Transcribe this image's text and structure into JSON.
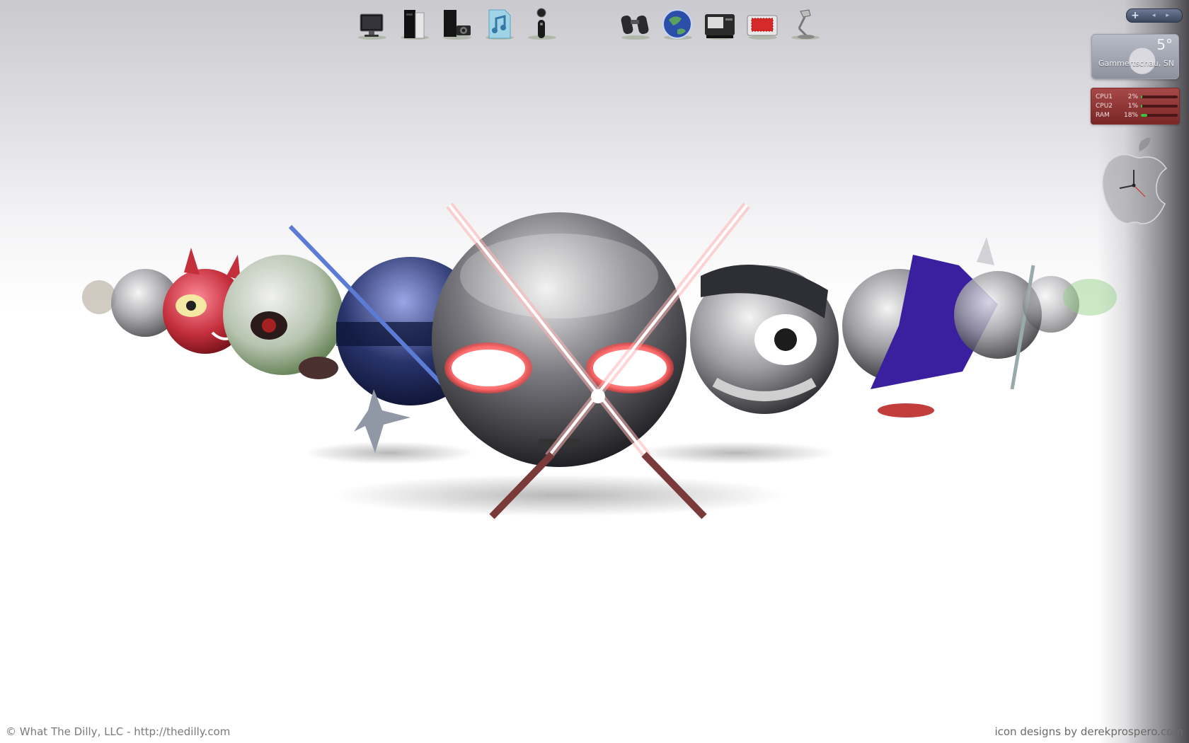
{
  "desktop": {
    "footer_left": "© What The Dilly, LLC  -  http://thedilly.com",
    "footer_right": "icon designs by derekprospero.com"
  },
  "dock": {
    "items": [
      {
        "icon": "monitor-icon"
      },
      {
        "icon": "computer-tower-icon"
      },
      {
        "icon": "camera-icon"
      },
      {
        "icon": "music-note-icon"
      },
      {
        "icon": "ipod-icon"
      },
      {
        "icon": "binoculars-icon"
      },
      {
        "icon": "globe-browser-icon"
      },
      {
        "icon": "scanner-icon"
      },
      {
        "icon": "red-display-icon"
      },
      {
        "icon": "lamp-icon"
      }
    ]
  },
  "gadgets": {
    "controls": {
      "plus_label": "+",
      "nav_label": "◂ ▸"
    },
    "weather": {
      "temperature": "5°",
      "location": "Gammertschau, SN"
    },
    "cpu_meter": {
      "rows": [
        {
          "label": "CPU1",
          "value": "2%",
          "level": 0.02
        },
        {
          "label": "CPU2",
          "value": "1%",
          "level": 0.01
        },
        {
          "label": "RAM",
          "value": "18%",
          "level": 0.18
        }
      ],
      "accent": "#3fbf3f"
    },
    "clock": {
      "icon": "apple-clock-icon"
    }
  }
}
